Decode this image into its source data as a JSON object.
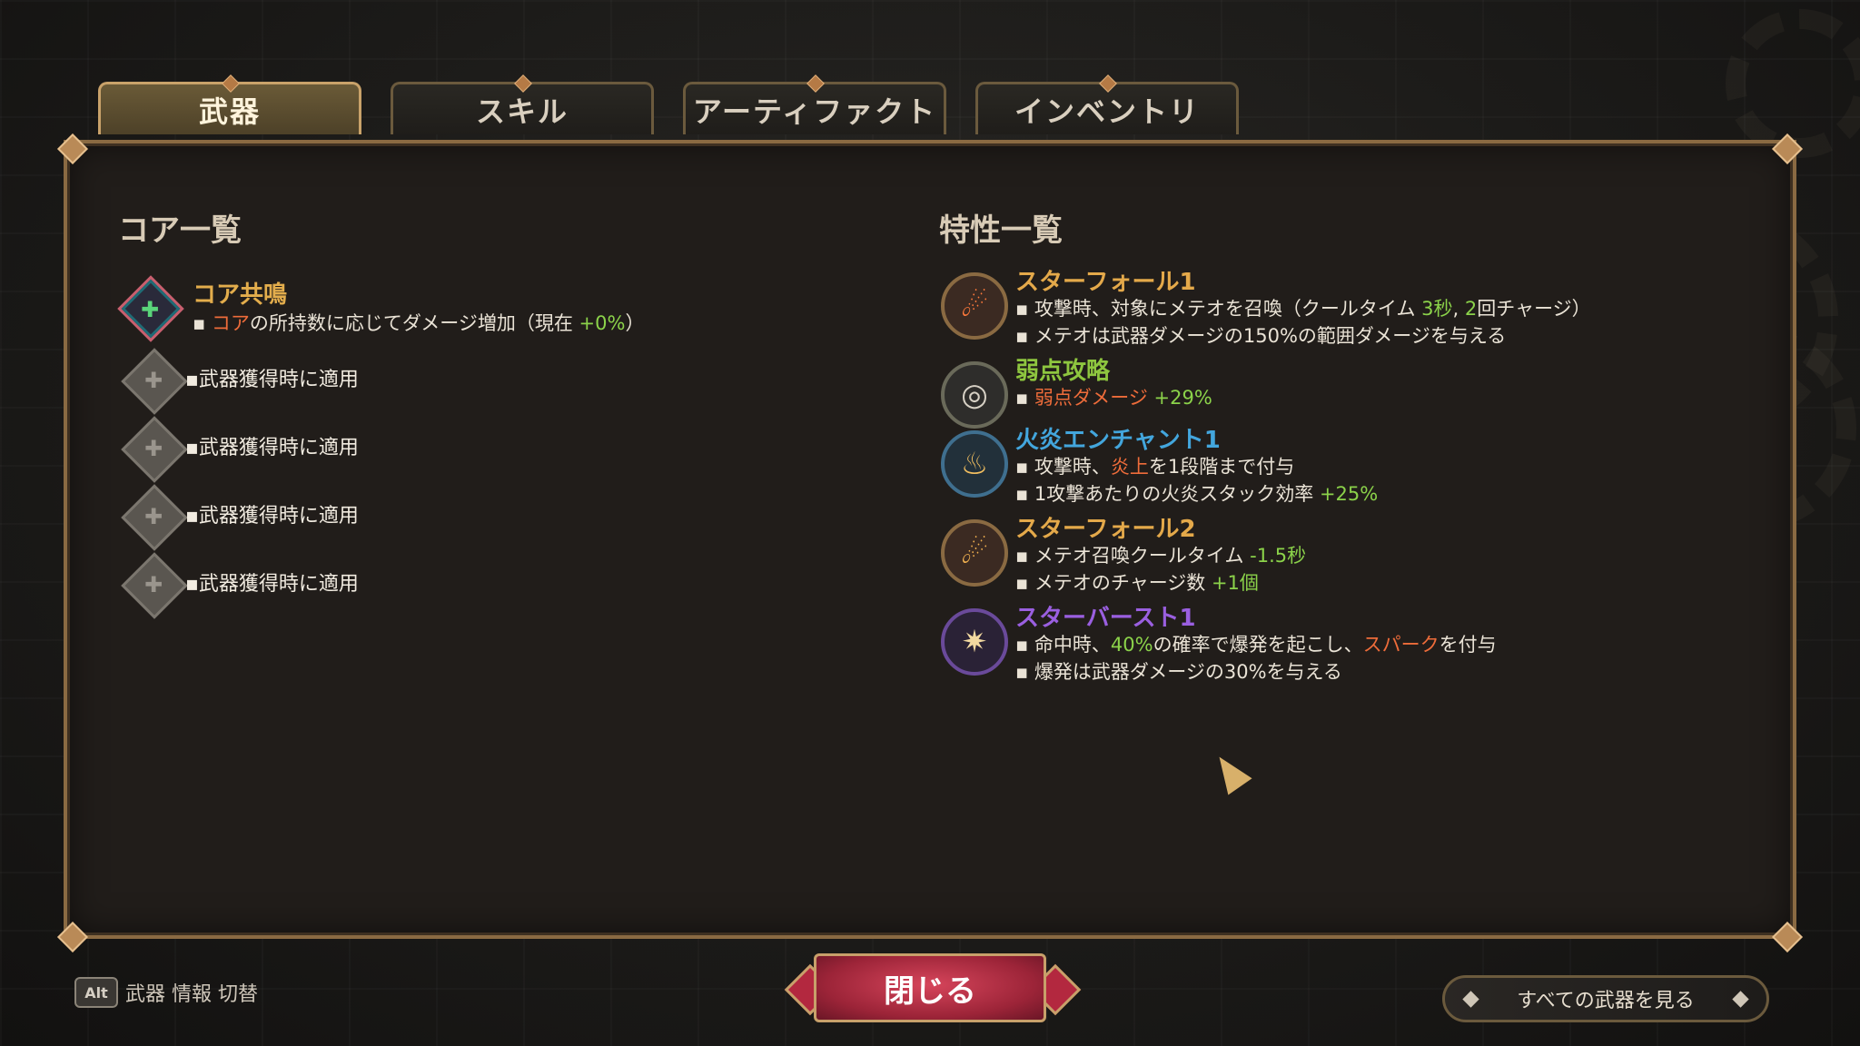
{
  "tabs": [
    {
      "label": "武器"
    },
    {
      "label": "スキル"
    },
    {
      "label": "アーティファクト"
    },
    {
      "label": "インベントリ"
    }
  ],
  "core": {
    "title": "コア一覧",
    "resonance": {
      "name": "コア共鳴",
      "desc_prefix": "▪ ",
      "desc_core": "コア",
      "desc_mid": "の所持数に応じてダメージ増加（現在 ",
      "desc_value": "+0%",
      "desc_suffix": "）"
    },
    "slots": [
      {
        "label": "▪武器獲得時に適用"
      },
      {
        "label": "▪武器獲得時に適用"
      },
      {
        "label": "▪武器獲得時に適用"
      },
      {
        "label": "▪武器獲得時に適用"
      }
    ]
  },
  "traits": {
    "title": "特性一覧",
    "starfall1": {
      "name": "スターフォール1",
      "l1a": "▪ 攻撃時、対象にメテオを召喚（クールタイム ",
      "l1b": "3秒",
      "l1c": ", ",
      "l1d": "2",
      "l1e": "回チャージ）",
      "l2": "▪ メテオは武器ダメージの150%の範囲ダメージを与える"
    },
    "weakpoint": {
      "name": "弱点攻略",
      "l1a": "▪ ",
      "l1b": "弱点ダメージ",
      "l1c": " +29%"
    },
    "fire": {
      "name": "火炎エンチャント1",
      "l1a": "▪ 攻撃時、",
      "l1b": "炎上",
      "l1c": "を1段階まで付与",
      "l2a": "▪ 1攻撃あたりの火炎スタック効率 ",
      "l2b": "+25%"
    },
    "starfall2": {
      "name": "スターフォール2",
      "l1a": "▪ メテオ召喚クールタイム ",
      "l1b": "-1.5秒",
      "l2a": "▪ メテオのチャージ数 ",
      "l2b": "+1個"
    },
    "starburst": {
      "name": "スターバースト1",
      "l1a": "▪ 命中時、",
      "l1b": "40%",
      "l1c": "の確率で爆発を起こし、",
      "l1d": "スパーク",
      "l1e": "を付与",
      "l2": "▪ 爆発は武器ダメージの30%を与える"
    }
  },
  "bottom": {
    "alt_key": "Alt",
    "alt_label": "武器 情報 切替",
    "close": "閉じる",
    "view_all": "すべての武器を見る"
  }
}
